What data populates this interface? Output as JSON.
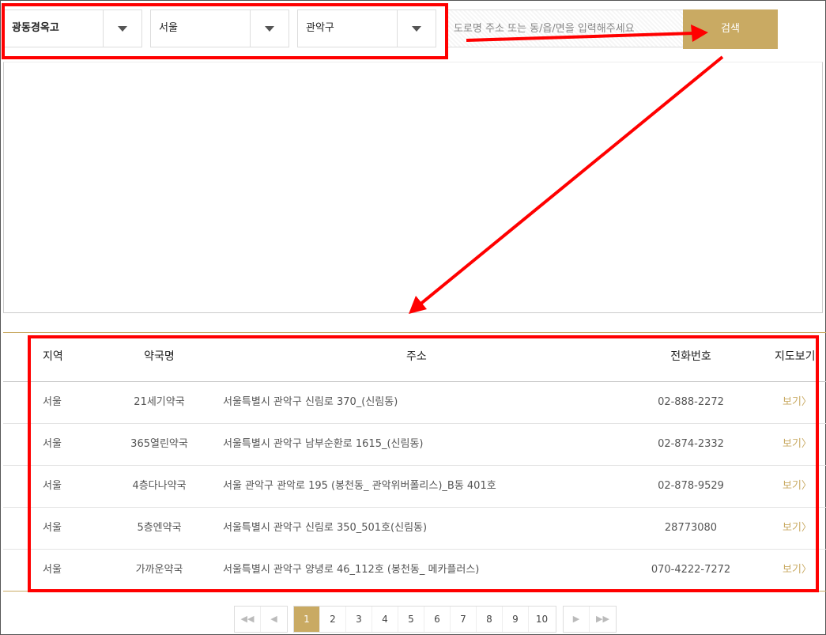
{
  "filters": {
    "type": "광동경옥고",
    "city": "서울",
    "district": "관악구"
  },
  "search": {
    "placeholder": "도로명 주소 또는 동/읍/면을 입력해주세요",
    "button_label": "검색"
  },
  "table": {
    "headers": {
      "region": "지역",
      "name": "약국명",
      "address": "주소",
      "phone": "전화번호",
      "map": "지도보기"
    },
    "rows": [
      {
        "region": "서울",
        "name": "21세기약국",
        "address": "서울특별시 관악구 신림로 370_(신림동)",
        "phone": "02-888-2272",
        "map": "보기"
      },
      {
        "region": "서울",
        "name": "365열린약국",
        "address": "서울특별시 관악구 남부순환로 1615_(신림동)",
        "phone": "02-874-2332",
        "map": "보기"
      },
      {
        "region": "서울",
        "name": "4층다나약국",
        "address": "서울 관악구 관악로 195 (봉천동_ 관악위버폴리스)_B동 401호",
        "phone": "02-878-9529",
        "map": "보기"
      },
      {
        "region": "서울",
        "name": "5층엔약국",
        "address": "서울특별시 관악구 신림로 350_501호(신림동)",
        "phone": "28773080",
        "map": "보기"
      },
      {
        "region": "서울",
        "name": "가까운약국",
        "address": "서울특별시 관악구 양녕로 46_112호 (봉천동_ 메카플러스)",
        "phone": "070-4222-7272",
        "map": "보기"
      }
    ]
  },
  "pagination": {
    "pages": [
      "1",
      "2",
      "3",
      "4",
      "5",
      "6",
      "7",
      "8",
      "9",
      "10"
    ],
    "current": "1",
    "first_symbol": "◀◀",
    "prev_symbol": "◀",
    "next_symbol": "▶",
    "last_symbol": "▶▶"
  },
  "colors": {
    "accent": "#c9aa63",
    "annotation": "#ff0000"
  }
}
